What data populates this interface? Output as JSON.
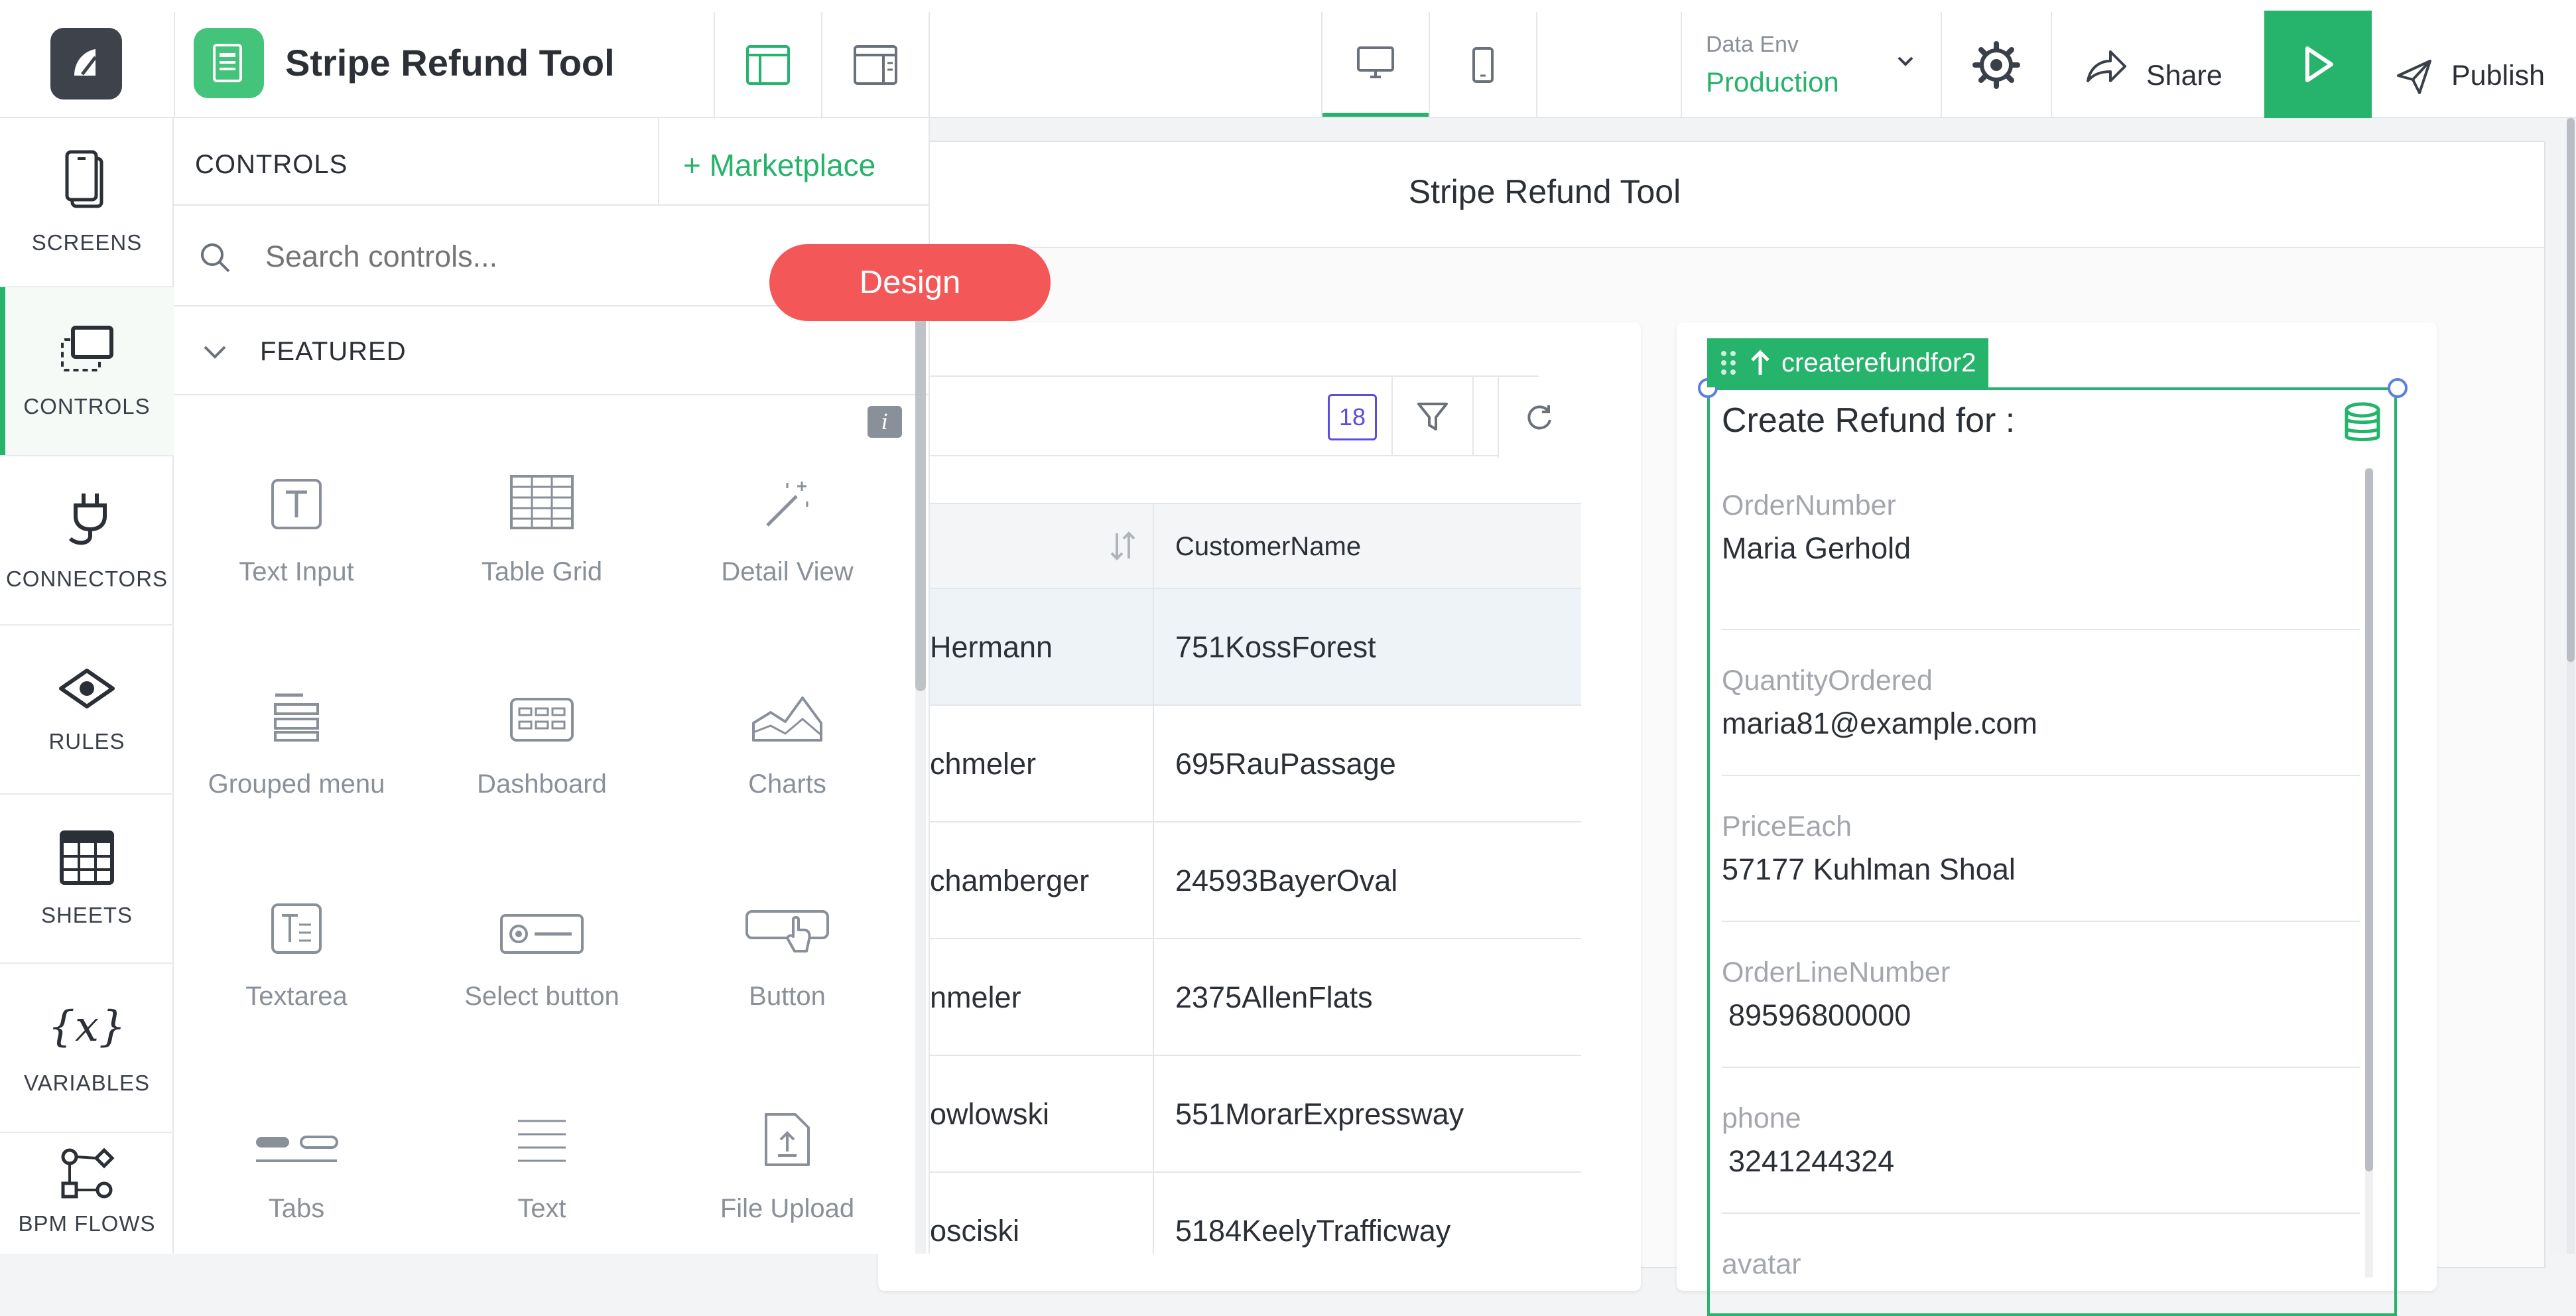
{
  "app": {
    "title": "Stripe Refund Tool",
    "data_env_label": "Data Env",
    "data_env_value": "Production",
    "share_label": "Share",
    "publish_label": "Publish"
  },
  "rail": [
    {
      "label": "SCREENS"
    },
    {
      "label": "CONTROLS"
    },
    {
      "label": "CONNECTORS"
    },
    {
      "label": "RULES"
    },
    {
      "label": "SHEETS"
    },
    {
      "label": "VARIABLES"
    },
    {
      "label": "BPM FLOWS"
    }
  ],
  "controls_panel": {
    "title": "CONTROLS",
    "marketplace": "+ Marketplace",
    "search_placeholder": "Search controls...",
    "section": "FEATURED",
    "info": "i",
    "items": [
      {
        "label": "Text Input",
        "icon": "text-input-icon"
      },
      {
        "label": "Table Grid",
        "icon": "table-grid-icon"
      },
      {
        "label": "Detail View",
        "icon": "magic-wand-icon"
      },
      {
        "label": "Grouped menu",
        "icon": "grouped-menu-icon"
      },
      {
        "label": "Dashboard",
        "icon": "dashboard-icon"
      },
      {
        "label": "Charts",
        "icon": "area-chart-icon"
      },
      {
        "label": "Textarea",
        "icon": "textarea-icon"
      },
      {
        "label": "Select button",
        "icon": "select-button-icon"
      },
      {
        "label": "Button",
        "icon": "button-icon"
      },
      {
        "label": "Tabs",
        "icon": "tabs-icon"
      },
      {
        "label": "Text",
        "icon": "text-icon"
      },
      {
        "label": "File Upload",
        "icon": "file-upload-icon"
      }
    ]
  },
  "design_badge": "Design",
  "screen": {
    "title": "Stripe Refund Tool"
  },
  "table": {
    "count": "18",
    "col2_header": "CustomerName",
    "rows": [
      {
        "c1": "Hermann",
        "c2": "751KossForest"
      },
      {
        "c1": "chmeler",
        "c2": "695RauPassage"
      },
      {
        "c1": "chamberger",
        "c2": "24593BayerOval"
      },
      {
        "c1": "nmeler",
        "c2": "2375AllenFlats"
      },
      {
        "c1": "owlowski",
        "c2": "551MorarExpressway"
      },
      {
        "c1": "osciski",
        "c2": "5184KeelyTrafficway"
      }
    ]
  },
  "detail": {
    "tag": "createrefundfor2",
    "heading": "Create Refund for :",
    "fields": [
      {
        "label": "OrderNumber",
        "value": "Maria Gerhold"
      },
      {
        "label": "QuantityOrdered",
        "value": "maria81@example.com"
      },
      {
        "label": "PriceEach",
        "value": "57177 Kuhlman Shoal"
      },
      {
        "label": "OrderLineNumber",
        "value": "89596800000"
      },
      {
        "label": "phone",
        "value": "3241244324"
      },
      {
        "label": "avatar",
        "value": ""
      }
    ]
  },
  "colors": {
    "accent": "#26b36b",
    "design_badge": "#f45757",
    "table_highlight": "#eef3f8"
  }
}
